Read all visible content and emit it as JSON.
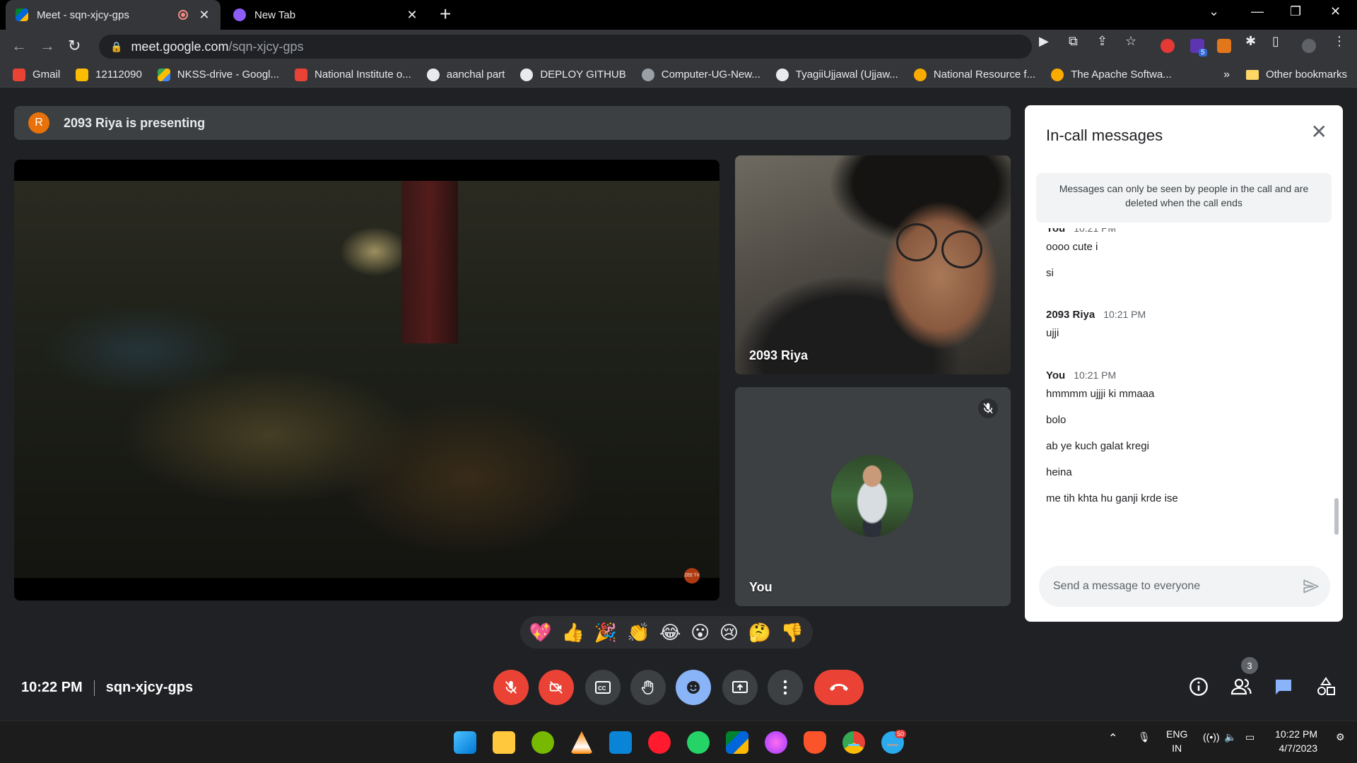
{
  "browser": {
    "tabs": [
      {
        "title": "Meet - sqn-xjcy-gps",
        "active": true
      },
      {
        "title": "New Tab",
        "active": false
      }
    ],
    "url_host": "meet.google.com",
    "url_path": "/sqn-xjcy-gps",
    "extension_badge": "5"
  },
  "bookmarks": [
    {
      "label": "Gmail",
      "color": "#ea4335"
    },
    {
      "label": "12112090",
      "color": "#fbbc04"
    },
    {
      "label": "NKSS-drive - Googl...",
      "color": "#34a853"
    },
    {
      "label": "National Institute o...",
      "color": "#ea4335"
    },
    {
      "label": "aanchal part",
      "color": "#e8eaed"
    },
    {
      "label": "DEPLOY GITHUB",
      "color": "#e8eaed"
    },
    {
      "label": "Computer-UG-New...",
      "color": "#9aa0a6"
    },
    {
      "label": "TyagiiUjjawal (Ujjaw...",
      "color": "#e8eaed"
    },
    {
      "label": "National Resource f...",
      "color": "#f9ab00"
    },
    {
      "label": "The Apache Softwa...",
      "color": "#f9ab00"
    }
  ],
  "bookmarks_more": "»",
  "bookmarks_other": "Other bookmarks",
  "meet": {
    "presenter_initial": "R",
    "presenting_text": "2093 Riya is presenting",
    "stage_watermark": "ZEE TV",
    "participants": [
      {
        "name": "2093 Riya"
      },
      {
        "name": "You",
        "muted": true
      }
    ],
    "meeting_time": "10:22 PM",
    "meeting_code": "sqn-xjcy-gps",
    "people_count": "3"
  },
  "chat": {
    "title": "In-call messages",
    "notice": "Messages can only be seen by people in the call and are deleted when the call ends",
    "groups": [
      {
        "sender": "You",
        "time": "10:21 PM",
        "messages": [
          "oooo cute i",
          "si"
        ]
      },
      {
        "sender": "2093 Riya",
        "time": "10:21 PM",
        "messages": [
          "ujji"
        ]
      },
      {
        "sender": "You",
        "time": "10:21 PM",
        "messages": [
          "hmmmm ujjji ki mmaaa",
          "bolo",
          "ab ye kuch galat kregi",
          "heina",
          "me tih khta hu ganji krde ise"
        ]
      }
    ],
    "placeholder": "Send a message to everyone"
  },
  "reactions": [
    "💖",
    "👍",
    "🎉",
    "👏",
    "😂",
    "😮",
    "😢",
    "🤔",
    "👎"
  ],
  "taskbar": {
    "telegram_badge": "50",
    "lang_1": "ENG",
    "lang_2": "IN",
    "clock_time": "10:22 PM",
    "clock_date": "4/7/2023"
  },
  "colors": {
    "meet_bg": "#202124",
    "red_control": "#ea4335",
    "active_reaction": "#8ab4f8",
    "chat_bg": "#ffffff"
  }
}
